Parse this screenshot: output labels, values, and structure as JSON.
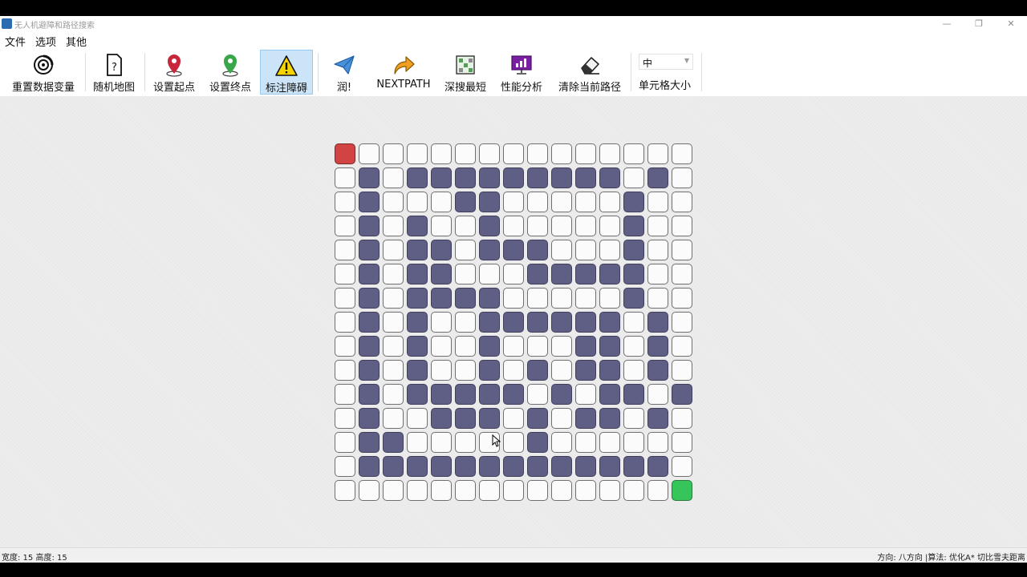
{
  "window": {
    "title": "无人机避障和路径搜索",
    "controls": {
      "minimize": "—",
      "restore": "❐",
      "close": "✕"
    }
  },
  "menu": [
    "文件",
    "选项",
    "其他"
  ],
  "toolbar": {
    "reset": "重置数据变量",
    "random_map": "随机地图",
    "set_start": "设置起点",
    "set_goal": "设置终点",
    "mark_obstacle": "标注障碍",
    "run": "润!",
    "next_path": "NEXTPATH",
    "dfs_shortest": "深搜最短",
    "perf": "性能分析",
    "clear_path": "清除当前路径",
    "cell_size_value": "中",
    "cell_size_label": "单元格大小",
    "active_tool": "mark_obstacle"
  },
  "grid": {
    "rows": [
      "S..............",
      ".#.#########.#.",
      ".#...##.....#.",
      ".#.#..#.....#..",
      ".#.##.###...#..",
      ".#.##...#####..",
      ".#.####.....#..",
      ".#.#..######.#.",
      ".#.#..#...##.#.",
      ".#.#..#.#.##.#.",
      ".#.#####.#.##.#.",
      ".#..###.#.##.#.",
      ".##.....#.......",
      ".#############.",
      "..............G"
    ]
  },
  "colors": {
    "wall": "#5f5f85",
    "start": "#d24343",
    "goal": "#35c55a",
    "empty": "#fbfbfb"
  },
  "status": {
    "left": "宽度: 15  高度: 15",
    "right": "方向: 八方向 |算法: 优化A* 切比雪夫距离"
  }
}
